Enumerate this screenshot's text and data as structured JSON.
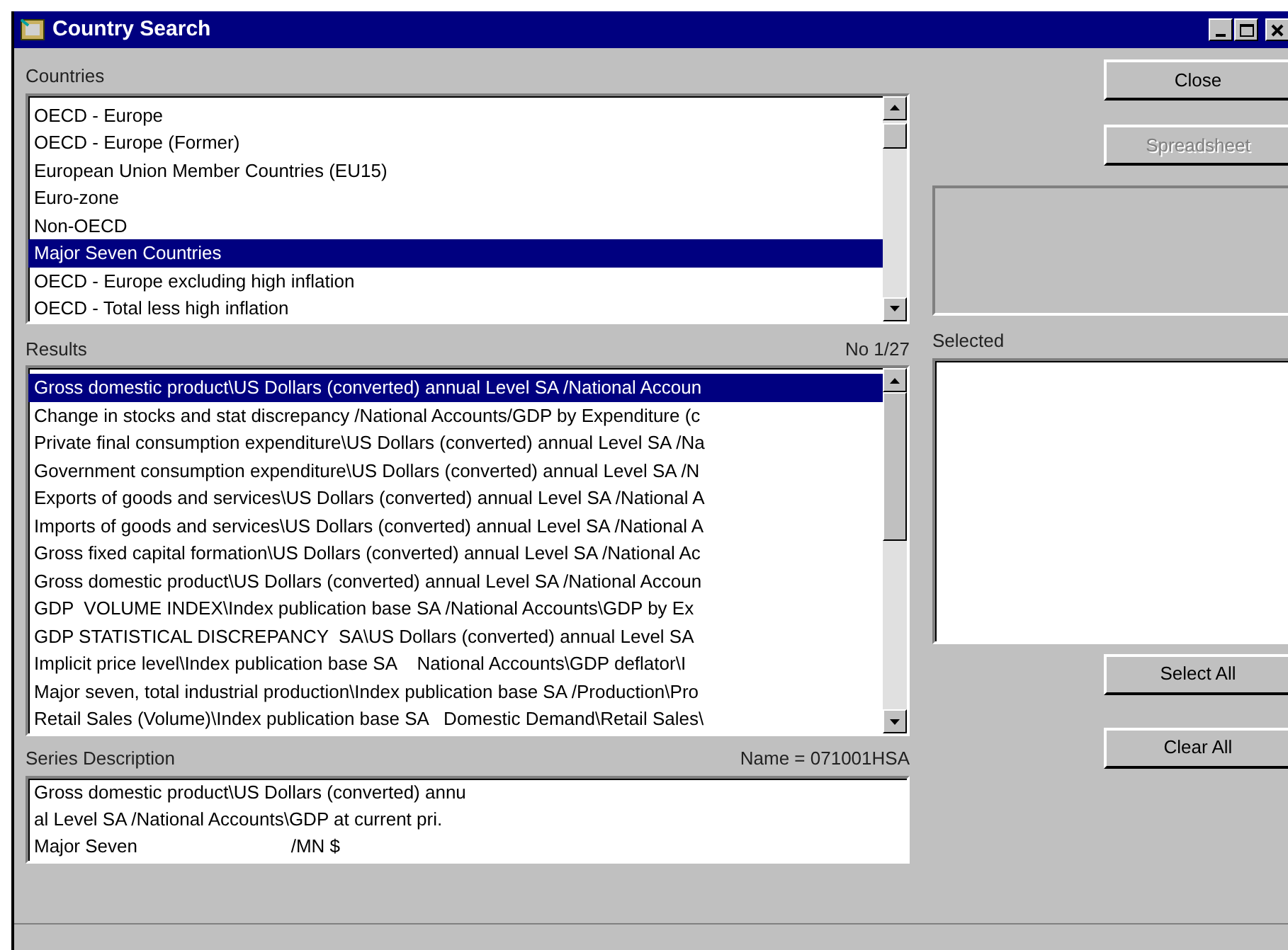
{
  "window": {
    "title": "Country Search"
  },
  "countries": {
    "label": "Countries",
    "items": [
      {
        "text": "OECD - Europe",
        "selected": false
      },
      {
        "text": "OECD - Europe (Former)",
        "selected": false
      },
      {
        "text": "European Union Member Countries (EU15)",
        "selected": false
      },
      {
        "text": "Euro-zone",
        "selected": false
      },
      {
        "text": "Non-OECD",
        "selected": false
      },
      {
        "text": "Major Seven Countries",
        "selected": true
      },
      {
        "text": "OECD - Europe excluding high inflation",
        "selected": false
      },
      {
        "text": "OECD - Total less high inflation",
        "selected": false
      }
    ]
  },
  "results": {
    "label": "Results",
    "count": "No 1/27",
    "items": [
      {
        "text": "Gross domestic product\\US Dollars (converted) annual Level SA /National Accoun",
        "selected": true
      },
      {
        "text": "Change in stocks and stat discrepancy /National Accounts/GDP by Expenditure (c",
        "selected": false
      },
      {
        "text": "Private final consumption expenditure\\US Dollars (converted) annual Level SA /Na",
        "selected": false
      },
      {
        "text": "Government consumption expenditure\\US Dollars (converted) annual Level SA /N",
        "selected": false
      },
      {
        "text": "Exports of goods and services\\US Dollars (converted) annual Level SA /National A",
        "selected": false
      },
      {
        "text": "Imports of goods and services\\US Dollars (converted) annual Level SA /National A",
        "selected": false
      },
      {
        "text": "Gross fixed capital formation\\US Dollars (converted) annual Level SA /National Ac",
        "selected": false
      },
      {
        "text": "Gross domestic product\\US Dollars (converted) annual Level SA /National Accoun",
        "selected": false
      },
      {
        "text": "GDP  VOLUME INDEX\\Index publication base SA /National Accounts\\GDP by Ex",
        "selected": false
      },
      {
        "text": "GDP STATISTICAL DISCREPANCY  SA\\US Dollars (converted) annual Level SA",
        "selected": false
      },
      {
        "text": "Implicit price level\\Index publication base SA    National Accounts\\GDP deflator\\I",
        "selected": false
      },
      {
        "text": "Major seven, total industrial production\\Index publication base SA /Production\\Pro",
        "selected": false
      },
      {
        "text": "Retail Sales (Volume)\\Index publication base SA   Domestic Demand\\Retail Sales\\",
        "selected": false
      }
    ]
  },
  "series_description": {
    "label": "Series Description",
    "name": "Name = 071001HSA",
    "lines": [
      "Gross domestic product\\US Dollars (converted) annu",
      "al Level SA /National Accounts\\GDP at current pri.",
      "Major Seven                              /MN $"
    ]
  },
  "buttons": [
    {
      "label": "Close",
      "disabled": false
    },
    {
      "label": "Spreadsheet",
      "disabled": true
    }
  ],
  "selected": {
    "label": "Selected"
  },
  "list_buttons": [
    {
      "label": "Select All",
      "disabled": false
    },
    {
      "label": "Clear All",
      "disabled": false
    }
  ]
}
